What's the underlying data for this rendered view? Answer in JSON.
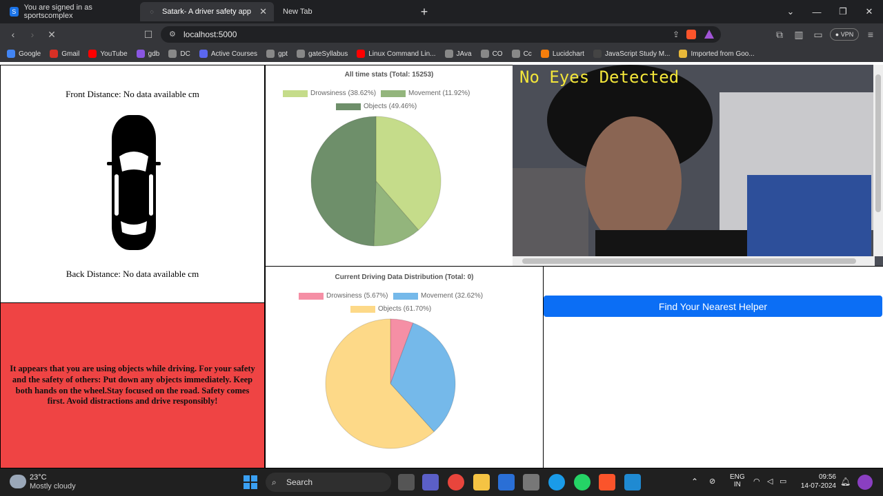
{
  "browser": {
    "tabs": [
      {
        "label": "You are signed in as sportscomplex",
        "active": false
      },
      {
        "label": "Satark- A driver safety app",
        "active": true
      },
      {
        "label": "New Tab",
        "active": false
      }
    ],
    "url": "localhost:5000",
    "vpn_label": "VPN",
    "bookmarks": [
      "Google",
      "Gmail",
      "YouTube",
      "gdb",
      "DC",
      "Active Courses",
      "gpt",
      "gateSyllabus",
      "Linux Command Lin...",
      "JAva",
      "CO",
      "Cc",
      "Lucidchart",
      "JavaScript Study M...",
      "Imported from Goo..."
    ]
  },
  "app": {
    "front_distance": "Front Distance: No data available cm",
    "back_distance": "Back Distance: No data available cm",
    "alert_message": "It appears that you are using objects while driving. For your safety and the safety of others: Put down any objects immediately. Keep both hands on the wheel.Stay focused on the road. Safety comes first. Avoid distractions and drive responsibly!",
    "camera_overlay": "No Eyes Detected",
    "helper_button": "Find Your Nearest Helper"
  },
  "chart_data": [
    {
      "type": "pie",
      "title": "All time stats (Total: 15253)",
      "categories": [
        "Drowsiness (38.62%)",
        "Movement (11.92%)",
        "Objects (49.46%)"
      ],
      "values": [
        38.62,
        11.92,
        49.46
      ],
      "colors": [
        "#c5dc8a",
        "#93b57c",
        "#6e8f6a"
      ]
    },
    {
      "type": "pie",
      "title": "Current Driving Data Distribution (Total: 0)",
      "categories": [
        "Drowsiness (5.67%)",
        "Movement (32.62%)",
        "Objects (61.70%)"
      ],
      "values": [
        5.67,
        32.62,
        61.7
      ],
      "colors": [
        "#f58fa5",
        "#75b9ea",
        "#fdd988"
      ]
    }
  ],
  "taskbar": {
    "weather_temp": "23°C",
    "weather_desc": "Mostly cloudy",
    "search_label": "Search",
    "lang_top": "ENG",
    "lang_bottom": "IN",
    "time": "09:56",
    "date": "14-07-2024"
  }
}
